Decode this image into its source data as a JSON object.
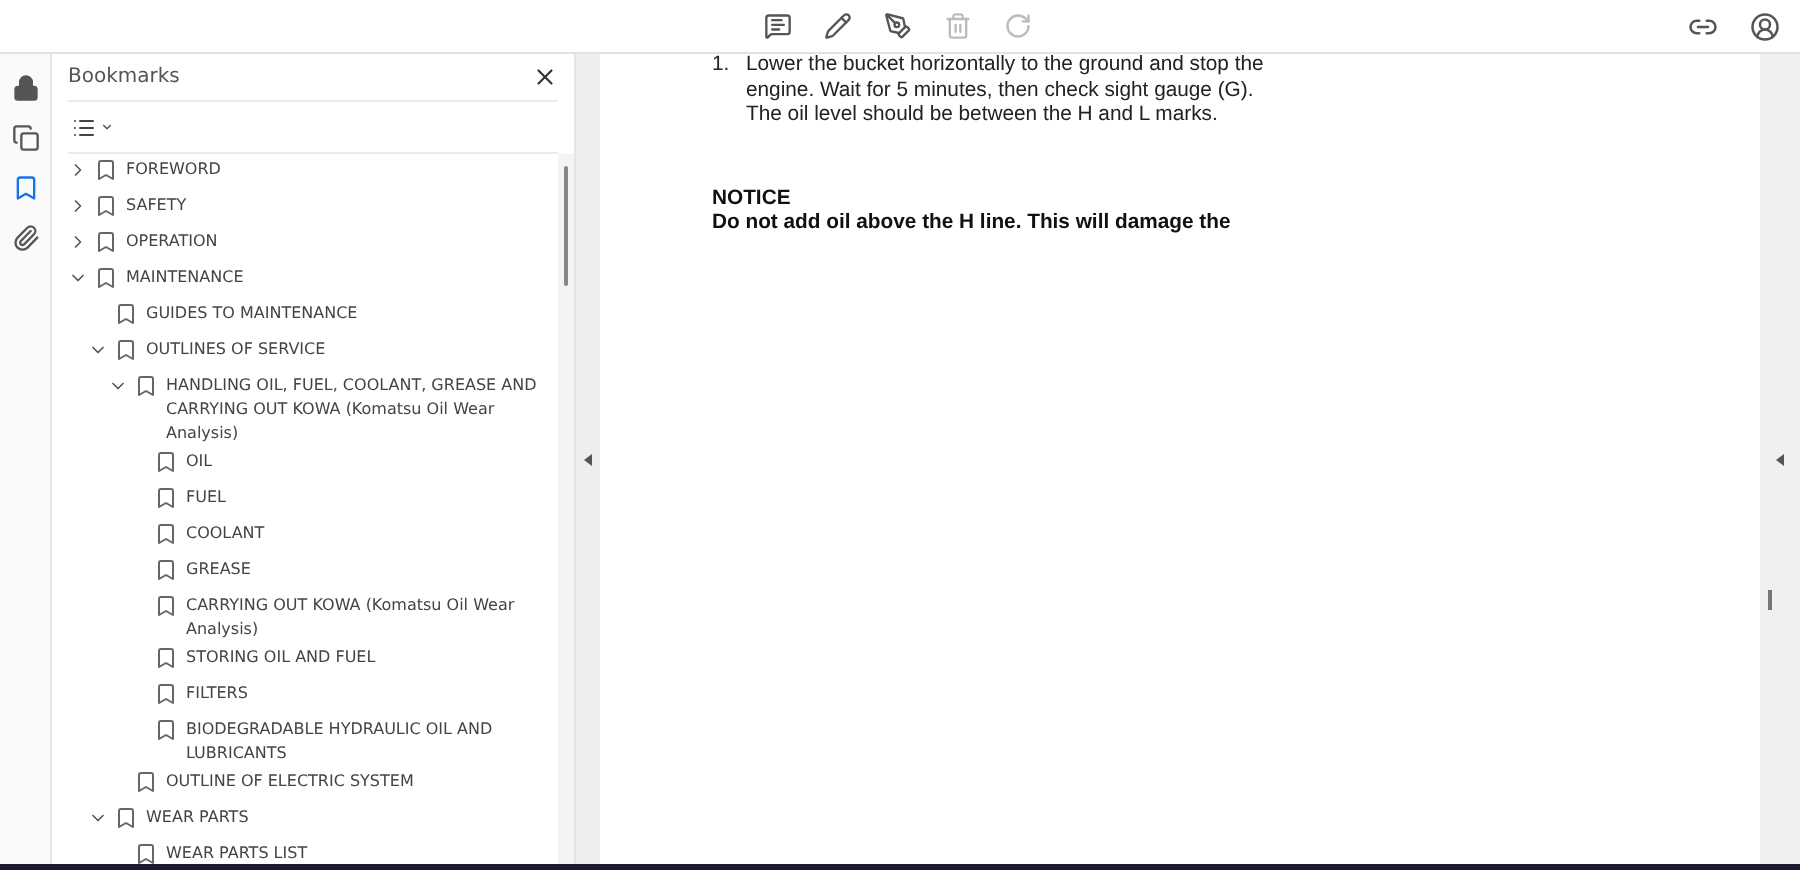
{
  "left_rail": [
    {
      "kind": "lock",
      "selected": false
    },
    {
      "kind": "pages",
      "selected": false
    },
    {
      "kind": "bookmark",
      "selected": true
    },
    {
      "kind": "attachment",
      "selected": false
    }
  ],
  "bookmarks_panel": {
    "title": "Bookmarks",
    "items": [
      {
        "label": "FOREWORD",
        "expanded": false
      },
      {
        "label": "SAFETY",
        "expanded": false
      },
      {
        "label": "OPERATION",
        "expanded": false
      },
      {
        "label": "MAINTENANCE",
        "expanded": true,
        "children": [
          {
            "label": "GUIDES TO MAINTENANCE"
          },
          {
            "label": "OUTLINES OF SERVICE",
            "expanded": true,
            "children": [
              {
                "label": "HANDLING OIL, FUEL, COOLANT, GREASE AND CARRYING OUT KOWA (Komatsu Oil Wear Analysis)",
                "expanded": true,
                "children": [
                  {
                    "label": "OIL"
                  },
                  {
                    "label": "FUEL"
                  },
                  {
                    "label": "COOLANT"
                  },
                  {
                    "label": "GREASE"
                  },
                  {
                    "label": "CARRYING OUT KOWA (Komatsu Oil Wear Analysis)"
                  },
                  {
                    "label": "STORING OIL AND FUEL"
                  },
                  {
                    "label": "FILTERS"
                  },
                  {
                    "label": "BIODEGRADABLE HYDRAULIC OIL AND LUBRICANTS"
                  }
                ]
              },
              {
                "label": "OUTLINE OF ELECTRIC SYSTEM"
              }
            ]
          },
          {
            "label": "WEAR PARTS",
            "expanded": true,
            "children": [
              {
                "label": "WEAR PARTS LIST"
              }
            ]
          }
        ]
      }
    ]
  },
  "document": {
    "step_number": "1.",
    "step_lines": [
      "Lower the bucket horizontally to the ground and stop the",
      "engine.  Wait for 5 minutes, then check sight gauge (G).",
      "The oil level should be between the H and L marks."
    ],
    "notice_title": "NOTICE",
    "notice_text": "Do not add oil above the H line.  This will damage the"
  }
}
